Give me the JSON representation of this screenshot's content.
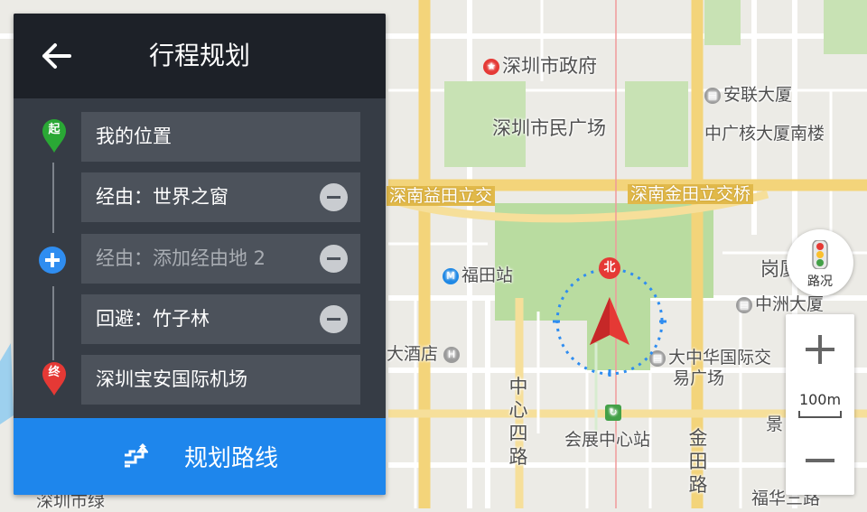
{
  "panel": {
    "title": "行程规划",
    "back_icon": "arrow-left-icon",
    "rows": [
      {
        "text": "我的位置",
        "marker": "起",
        "marker_color": "#2aa835"
      },
      {
        "text": "经由：世界之窗"
      },
      {
        "text": "经由：添加经由地 2",
        "placeholder": true
      },
      {
        "text": "回避：竹子林"
      },
      {
        "text": "深圳宝安国际机场",
        "marker": "终",
        "marker_color": "#e53935"
      }
    ],
    "plan_button": "规划路线"
  },
  "controls": {
    "traffic_label": "路况",
    "scale_label": "100m",
    "compass_north": "北"
  },
  "map": {
    "labels": [
      {
        "name": "label-shenzhen-gov",
        "text": "深圳市政府"
      },
      {
        "name": "label-anlian",
        "text": "安联大厦"
      },
      {
        "name": "label-citizen-square",
        "text": "深圳市民广场"
      },
      {
        "name": "label-cgn-south",
        "text": "中广核大厦南楼"
      },
      {
        "name": "label-futian-station",
        "text": "福田站"
      },
      {
        "name": "label-gangxia",
        "text": "岗厦"
      },
      {
        "name": "label-zhongzhou",
        "text": "中洲大厦"
      },
      {
        "name": "label-hotel",
        "text": "大酒店"
      },
      {
        "name": "label-exchange",
        "text": "大中华国际交易广场"
      },
      {
        "name": "label-zhongxin-road",
        "text": "中心四路"
      },
      {
        "name": "label-convention-station",
        "text": "会展中心站"
      },
      {
        "name": "label-jintian-road",
        "text": "金田路"
      },
      {
        "name": "label-shenzhen-green",
        "text": "深圳市绿"
      },
      {
        "name": "label-fuhua-road",
        "text": "福华三路"
      },
      {
        "name": "label-jing",
        "text": "景"
      }
    ],
    "road_labels": [
      {
        "name": "road-yitian",
        "text": "深南益田立交"
      },
      {
        "name": "road-jintian",
        "text": "深南金田立交桥"
      }
    ]
  }
}
